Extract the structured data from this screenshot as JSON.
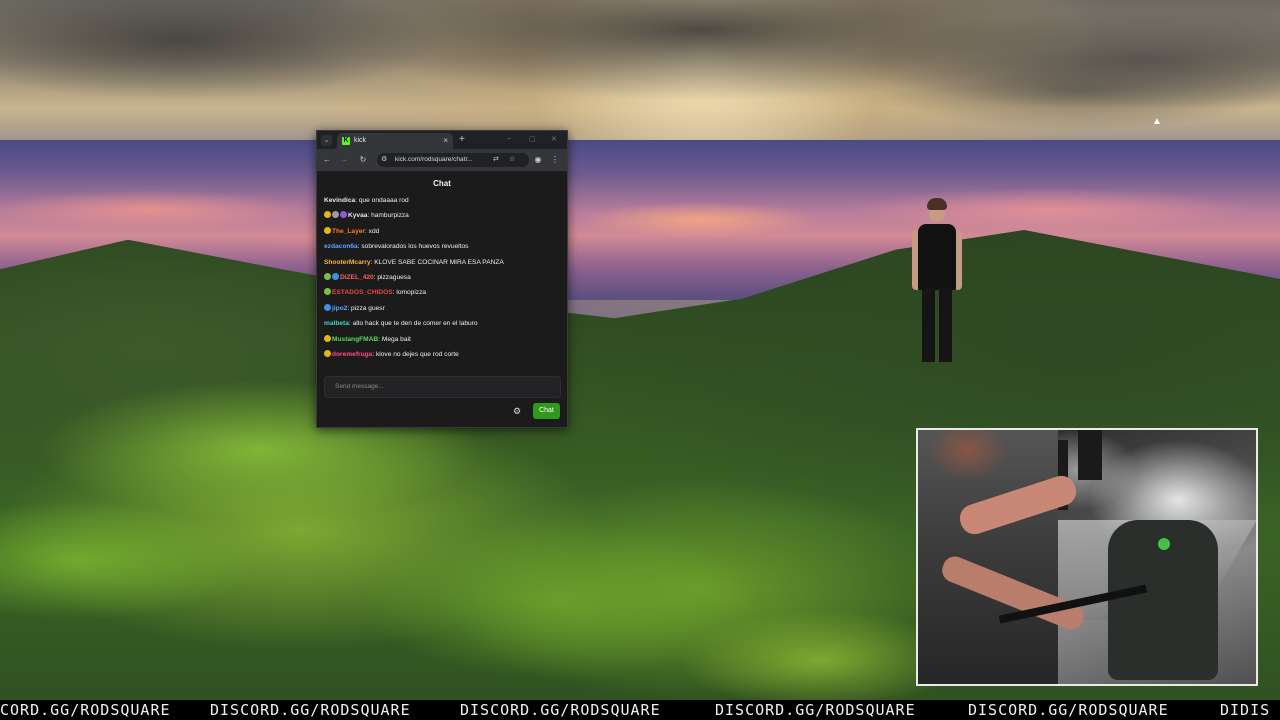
{
  "browser": {
    "tab_title": "kick",
    "tab_favicon": "K",
    "tab_close": "×",
    "new_tab": "+",
    "tab_dropdown": "⌄",
    "url": "kick.com/rodsquare/chatr...",
    "window_controls": [
      "–",
      "▢",
      "✕"
    ]
  },
  "chat": {
    "title": "Chat",
    "messages": [
      {
        "user": "Kevindica",
        "user_color": "#e8e8e8",
        "text": ": que ondaaaa rod",
        "badges": []
      },
      {
        "user": "Kyvaa",
        "user_color": "#e8e8e8",
        "text": ": hamburpizza",
        "badges": [
          "#e2b51d",
          "#9e9e9e",
          "#8a5bd6"
        ]
      },
      {
        "user": "The_Layer",
        "user_color": "#ff7a1a",
        "text": ": xdd",
        "badges": [
          "#e2b51d"
        ]
      },
      {
        "user": "ezdacon6a",
        "user_color": "#5aa7ff",
        "text": ": sobrevalorados los huevos revueltos",
        "badges": []
      },
      {
        "user": "ShooterMcarry",
        "user_color": "#f7b531",
        "text": ": KLOVE SABE COCINAR MIRA ESA PANZA",
        "badges": []
      },
      {
        "user": "DIZEL_420",
        "user_color": "#ff5a5a",
        "text": ": pizzaguesa",
        "badges": [
          "#7ac142",
          "#3f8ee8"
        ]
      },
      {
        "user": "ESTADOS_CHIDOS",
        "user_color": "#e8463a",
        "text": ": lomopizza",
        "badges": [
          "#7ac142"
        ]
      },
      {
        "user": "jipo2",
        "user_color": "#5aa7ff",
        "text": ": pizza guesr",
        "badges": [
          "#3f8ee8"
        ]
      },
      {
        "user": "malbeta",
        "user_color": "#3dd6c6",
        "text": ": alto hack que te den de comer en el laburo",
        "badges": []
      },
      {
        "user": "MustangFMAB",
        "user_color": "#5ad65a",
        "text": ": Mega bait",
        "badges": [
          "#e2b51d"
        ]
      },
      {
        "user": "doremefruga",
        "user_color": "#ff4a7a",
        "text": ": klove no dejes que rod corte",
        "badges": [
          "#e2b51d"
        ]
      }
    ],
    "input_placeholder": "Send message...",
    "send_label": "Chat"
  },
  "ticker": {
    "segments": [
      {
        "text": "CORD.GG/RODSQUARE"
      },
      {
        "text": "DISCORD.GG/RODSQUARE"
      },
      {
        "text": "DISCORD.GG/RODSQUARE"
      },
      {
        "text": "DISCORD.GG/RODSQUARE"
      },
      {
        "text": "DISCORD.GG/RODSQUARE"
      },
      {
        "text": "DIDIS"
      }
    ]
  },
  "icons": {
    "back": "back-arrow-icon",
    "forward": "forward-arrow-icon",
    "reload": "reload-icon",
    "settings": "gear-icon"
  },
  "colors": {
    "kick_green": "#53fc18",
    "send_button": "#2f9a1a"
  }
}
